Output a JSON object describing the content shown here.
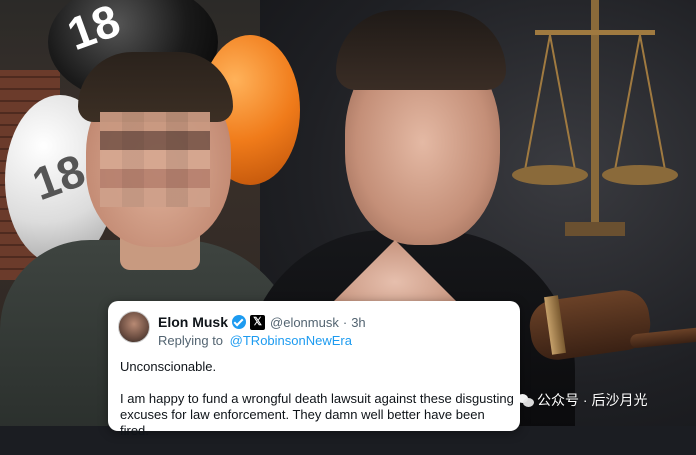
{
  "balloons": {
    "black_text": "18",
    "white_text": "18"
  },
  "tweet": {
    "display_name": "Elon Musk",
    "handle": "@elonmusk",
    "separator": "·",
    "time": "3h",
    "replying_prefix": "Replying to",
    "replying_handle": "@TRobinsonNewEra",
    "paragraphs": [
      "Unconscionable.",
      "I am happy to fund a wrongful death lawsuit against these disgusting excuses for law enforcement. They damn well better have been fired."
    ],
    "platform_icon": "x-icon",
    "verified_color": "#1d9bf0"
  },
  "watermark": {
    "text": "公众号 · 后沙月光",
    "icon": "wechat-icon"
  }
}
